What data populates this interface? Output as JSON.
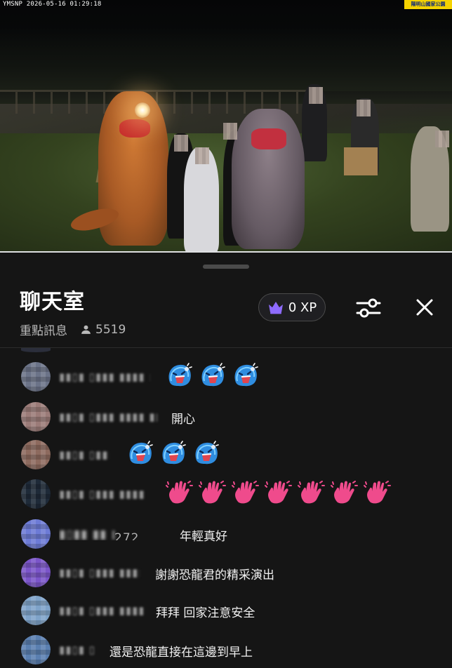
{
  "video": {
    "timestamp": "YMSNP 2026-05-16 01:29:18",
    "logo_text": "陽明山國家公園"
  },
  "chat": {
    "title": "聊天室",
    "mode_label": "重點訊息",
    "viewer_count": "5519",
    "xp_label": "0 XP",
    "icons": {
      "viewers": "person-icon",
      "xp": "crown-icon",
      "settings": "sliders-icon",
      "close": "close-icon"
    },
    "accent_colors": {
      "crown": "#8e6bff",
      "panel_bg": "#151515"
    },
    "messages": [
      {
        "username": "(blurred)",
        "text": "",
        "emoji": "blue-happy-blob-emoji",
        "emoji_count": 3,
        "avatar_color": "#6b7388"
      },
      {
        "username": "(blurred)",
        "text": "開心",
        "emoji": "",
        "emoji_count": 0,
        "avatar_color": "#9b7b78"
      },
      {
        "username": "(blurred)",
        "text": "",
        "emoji": "blue-happy-blob-emoji",
        "emoji_count": 3,
        "avatar_color": "#8d6a5e"
      },
      {
        "username": "(blurred)",
        "text": "",
        "emoji": "pink-waving-hand-emoji",
        "emoji_count": 7,
        "avatar_color": "#1e2a38"
      },
      {
        "username": "272",
        "text": "年輕真好",
        "emoji": "",
        "emoji_count": 0,
        "avatar_color": "#6d7bd6"
      },
      {
        "username": "(blurred)",
        "text": "謝謝恐龍君的精采演出",
        "emoji": "",
        "emoji_count": 0,
        "avatar_color": "#7b55c9"
      },
      {
        "username": "(blurred)",
        "text": "拜拜 回家注意安全",
        "emoji": "",
        "emoji_count": 0,
        "avatar_color": "#7fa3c9"
      },
      {
        "username": "(blurred)",
        "text": "還是恐龍直接在這邊到早上",
        "emoji": "",
        "emoji_count": 0,
        "avatar_color": "#5a7fb0"
      }
    ]
  }
}
